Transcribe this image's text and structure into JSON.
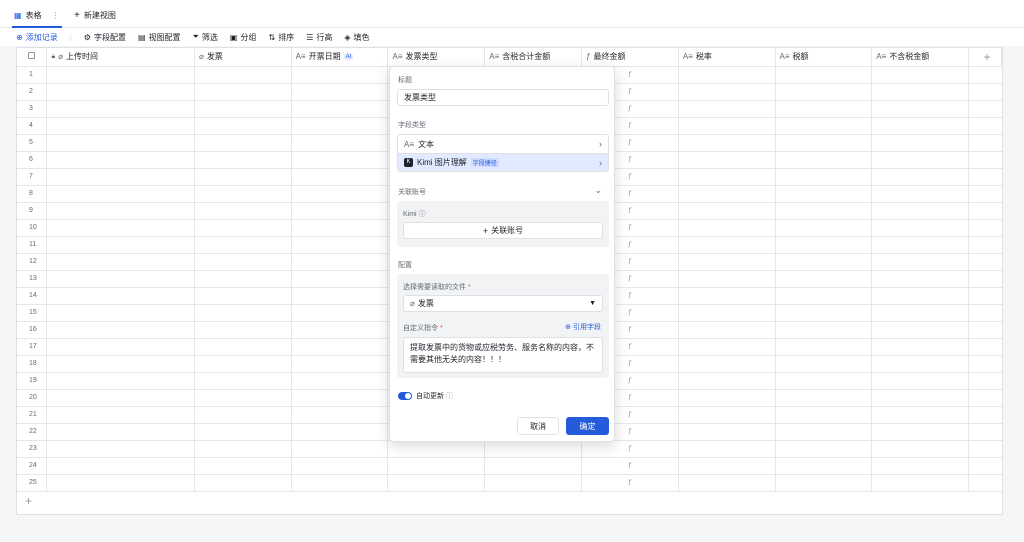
{
  "tabs": {
    "table_label": "表格",
    "table_menu": "⋮",
    "new_view_label": "新建视图"
  },
  "toolbar": {
    "add_record": "添加记录",
    "field_config": "字段配置",
    "view_config": "视图配置",
    "filter": "筛选",
    "group": "分组",
    "sort": "排序",
    "row_height": "行高",
    "fill_color": "填色"
  },
  "columns": [
    {
      "name": "上传时间",
      "icon": "paperclip-icon"
    },
    {
      "name": "发票",
      "icon": "paperclip-icon"
    },
    {
      "name": "开票日期",
      "icon": "text-icon",
      "badge": "AI"
    },
    {
      "name": "发票类型",
      "icon": "text-icon"
    },
    {
      "name": "含税合计金额",
      "icon": "text-icon"
    },
    {
      "name": "最终金额",
      "icon": "formula-icon"
    },
    {
      "name": "税率",
      "icon": "text-icon"
    },
    {
      "name": "税额",
      "icon": "text-icon"
    },
    {
      "name": "不含税金额",
      "icon": "text-icon"
    }
  ],
  "rows": [
    "1",
    "2",
    "3",
    "4",
    "5",
    "6",
    "7",
    "8",
    "9",
    "10",
    "11",
    "12",
    "13",
    "14",
    "15",
    "16",
    "17",
    "18",
    "19",
    "20",
    "21",
    "22",
    "23",
    "24",
    "25"
  ],
  "panel": {
    "title_label": "标题",
    "title_value": "发票类型",
    "field_type_label": "字段类型",
    "type_text": "文本",
    "type_kimi": "Kimi 图片理解",
    "type_kimi_tag": "字段捷径",
    "linked_account_label": "关联账号",
    "kimi_label": "Kimi",
    "link_account_button": "关联账号",
    "config_label": "配置",
    "file_select_label": "选择需要读取的文件",
    "file_select_value": "发票",
    "custom_prompt_label": "自定义指令",
    "ref_field": "引用字段",
    "prompt_text": "提取发票中的货物或应税劳务、服务名称的内容，不需要其他无关的内容！！！",
    "auto_update": "自动更新",
    "cancel": "取消",
    "confirm": "确定"
  },
  "colors": {
    "accent": "#245bdb"
  }
}
